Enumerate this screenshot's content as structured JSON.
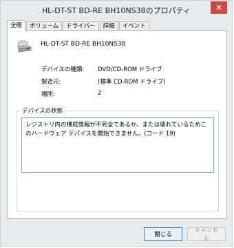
{
  "window": {
    "title": "HL-DT-ST BD-RE  BH10NS38のプロパティ",
    "close_glyph": "✕"
  },
  "tabs": [
    {
      "label": "全般",
      "active": true
    },
    {
      "label": "ボリューム",
      "active": false
    },
    {
      "label": "ドライバー",
      "active": false
    },
    {
      "label": "詳細",
      "active": false
    },
    {
      "label": "イベント",
      "active": false
    }
  ],
  "general": {
    "device_icon": "optical-drive-icon",
    "device_name": "HL-DT-ST BD-RE  BH10NS38",
    "properties": [
      {
        "label": "デバイスの種類:",
        "value": "DVD/CD-ROM ドライブ"
      },
      {
        "label": "製造元:",
        "value": "(標準 CD-ROM ドライブ)"
      },
      {
        "label": "場所:",
        "value": "2"
      }
    ],
    "status_group_title": "デバイスの状態",
    "status_text": "レジストリ内の構成情報が不完全であるか、または壊れているためこのハードウェア デバイスを開始できません。(コード 19)"
  },
  "buttons": {
    "close_label": "閉じる",
    "cancel_label": "キャンセル"
  },
  "colors": {
    "close_button_bg": "#c94a3e",
    "status_border": "#7a9ccf"
  }
}
